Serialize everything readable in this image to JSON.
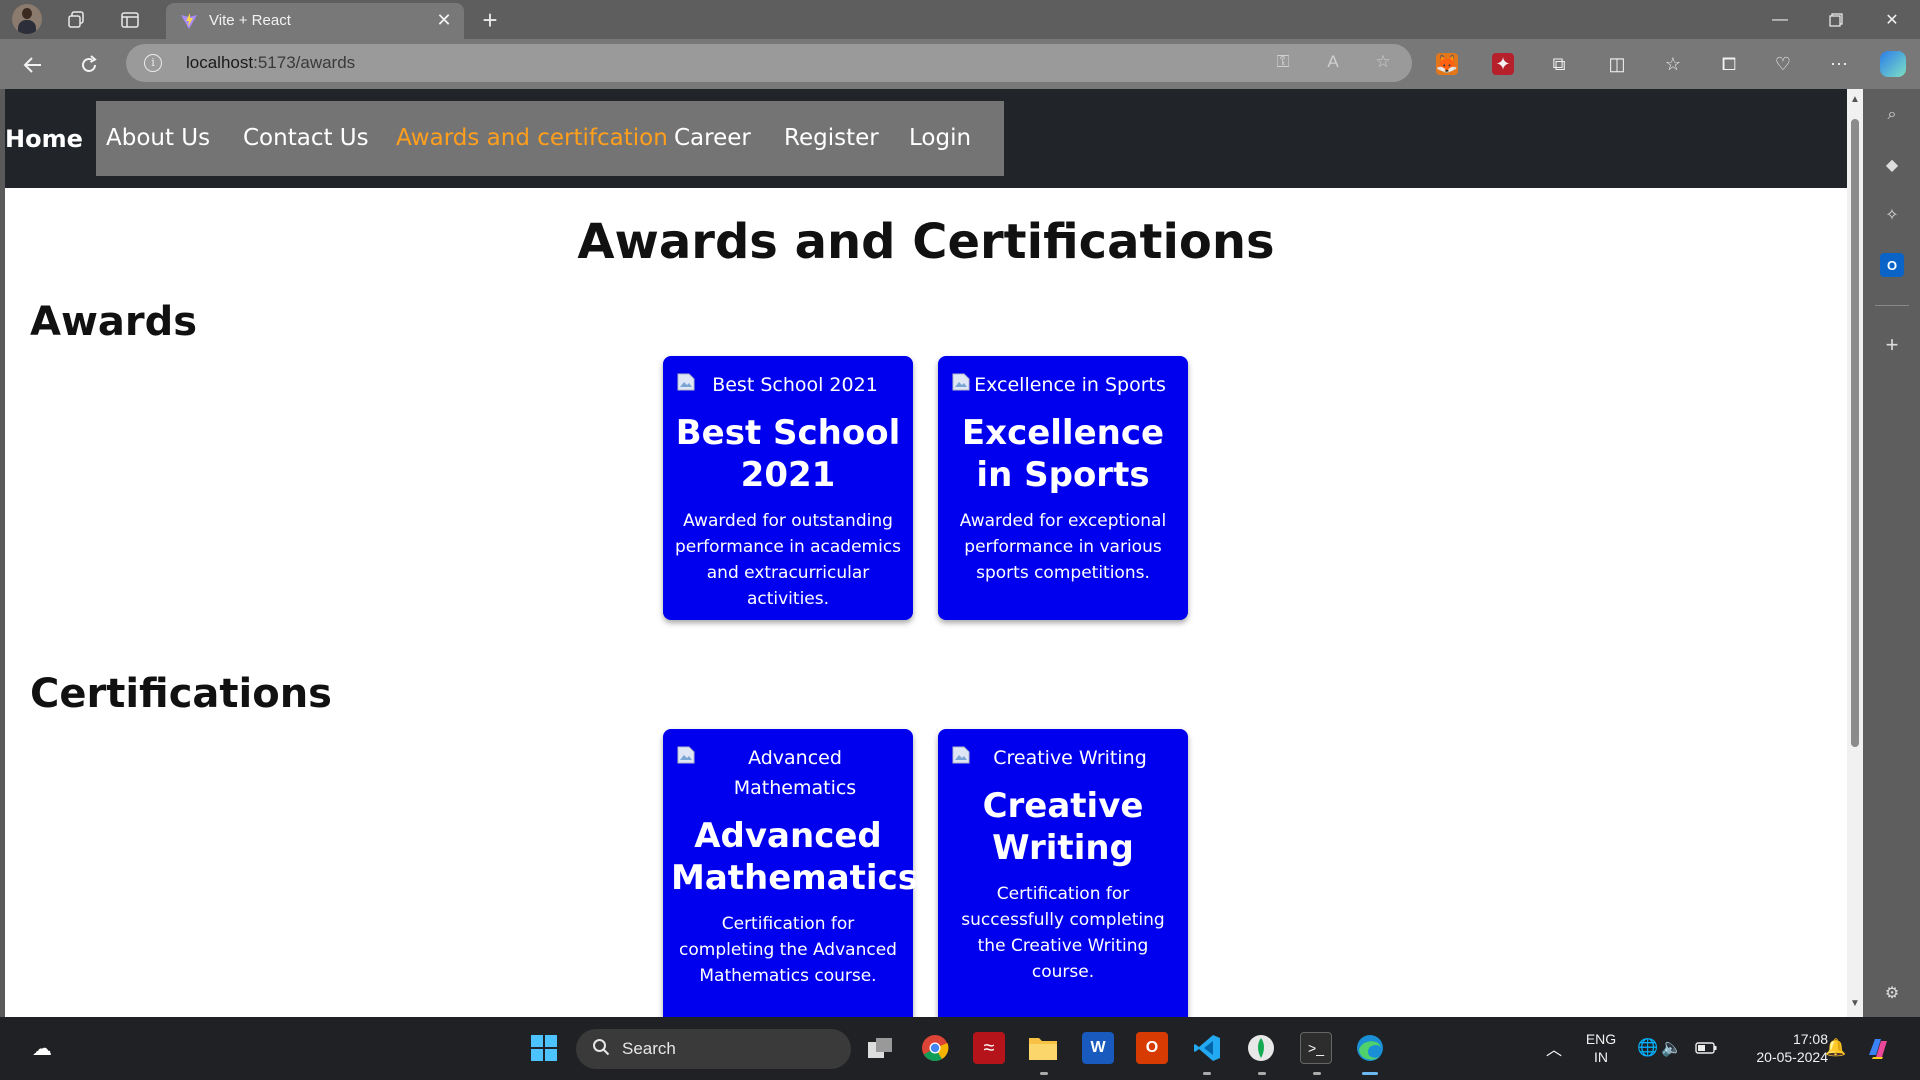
{
  "browser": {
    "tab_title": "Vite + React",
    "url_host": "localhost",
    "url_path": ":5173/awards"
  },
  "navbar": {
    "brand": "Home",
    "links": [
      "About Us",
      "Contact Us",
      "Awards and certifcation",
      "Career",
      "Register",
      "Login"
    ],
    "active_index": 2
  },
  "page": {
    "title": "Awards and Certifications",
    "awards_heading": "Awards",
    "certifications_heading": "Certifications"
  },
  "awards": [
    {
      "alt": "Best School 2021",
      "title": "Best School 2021",
      "text": "Awarded for outstanding performance in academics and extracurricular activities."
    },
    {
      "alt": "Excellence in Sports",
      "title": "Excellence in Sports",
      "text": "Awarded for exceptional performance in various sports competitions."
    }
  ],
  "certifications": [
    {
      "alt": "Advanced Mathematics",
      "title": "Advanced Mathematics",
      "text": "Certification for completing the Advanced Mathematics course."
    },
    {
      "alt": "Creative Writing",
      "title": "Creative Writing",
      "text": "Certification for successfully completing the Creative Writing course."
    }
  ],
  "taskbar": {
    "search_placeholder": "Search",
    "lang_top": "ENG",
    "lang_bottom": "IN",
    "time": "17:08",
    "date": "20-05-2024"
  },
  "colors": {
    "card_bg": "#0000ee",
    "navbar_bg": "#212529",
    "active_link": "#ff9f1c"
  }
}
